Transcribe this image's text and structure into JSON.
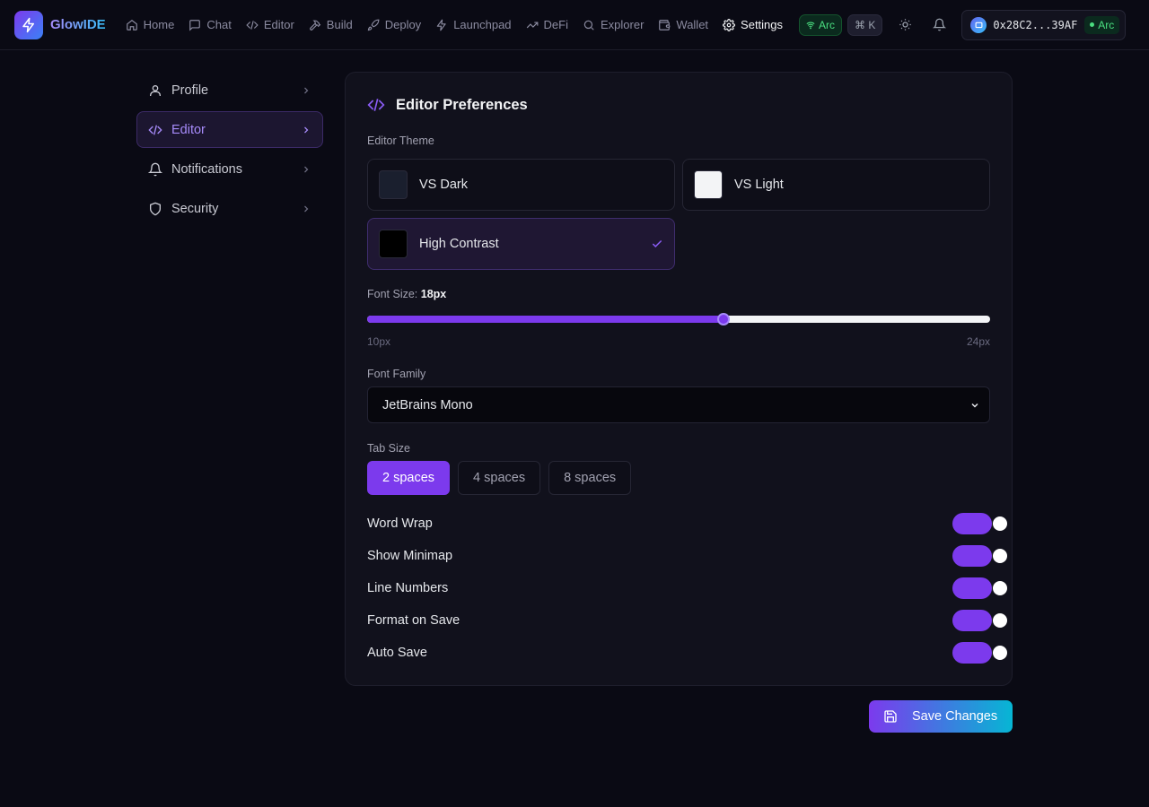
{
  "app": {
    "name": "GlowIDE"
  },
  "nav": {
    "items": [
      {
        "label": "Home",
        "icon": "home-icon"
      },
      {
        "label": "Chat",
        "icon": "chat-icon"
      },
      {
        "label": "Editor",
        "icon": "code-icon"
      },
      {
        "label": "Build",
        "icon": "hammer-icon"
      },
      {
        "label": "Deploy",
        "icon": "rocket-icon"
      },
      {
        "label": "Launchpad",
        "icon": "zap-icon"
      },
      {
        "label": "DeFi",
        "icon": "trending-up-icon"
      },
      {
        "label": "Explorer",
        "icon": "search-icon"
      },
      {
        "label": "Wallet",
        "icon": "wallet-icon"
      },
      {
        "label": "Settings",
        "icon": "gear-icon",
        "active": true
      }
    ],
    "network": "Arc",
    "shortcut": "⌘ K",
    "wallet_address": "0x28C2...39AF",
    "wallet_chain": "Arc"
  },
  "sidebar": {
    "items": [
      {
        "label": "Profile",
        "icon": "user-icon"
      },
      {
        "label": "Editor",
        "icon": "code-icon",
        "active": true
      },
      {
        "label": "Notifications",
        "icon": "bell-icon"
      },
      {
        "label": "Security",
        "icon": "shield-icon"
      }
    ]
  },
  "editor": {
    "title": "Editor Preferences",
    "theme_label": "Editor Theme",
    "themes": [
      {
        "name": "VS Dark",
        "swatch": "#1a1f2e"
      },
      {
        "name": "VS Light",
        "swatch": "#f3f4f6"
      },
      {
        "name": "High Contrast",
        "swatch": "#000000",
        "selected": true
      }
    ],
    "font_size_label": "Font Size:",
    "font_size_value": "18px",
    "font_size": {
      "min": 10,
      "max": 24,
      "value": 18
    },
    "font_size_min_label": "10px",
    "font_size_max_label": "24px",
    "font_family_label": "Font Family",
    "font_family_value": "JetBrains Mono",
    "tab_size_label": "Tab Size",
    "tab_sizes": [
      "2 spaces",
      "4 spaces",
      "8 spaces"
    ],
    "tab_size_selected": 0,
    "toggles": [
      {
        "label": "Word Wrap",
        "on": true
      },
      {
        "label": "Show Minimap",
        "on": true
      },
      {
        "label": "Line Numbers",
        "on": true
      },
      {
        "label": "Format on Save",
        "on": true
      },
      {
        "label": "Auto Save",
        "on": true
      }
    ],
    "save_label": "Save Changes"
  },
  "colors": {
    "accent": "#7c3aed",
    "accent_light": "#a78bfa",
    "success": "#4ade80",
    "background": "#0a0a14",
    "panel": "#11111c"
  }
}
